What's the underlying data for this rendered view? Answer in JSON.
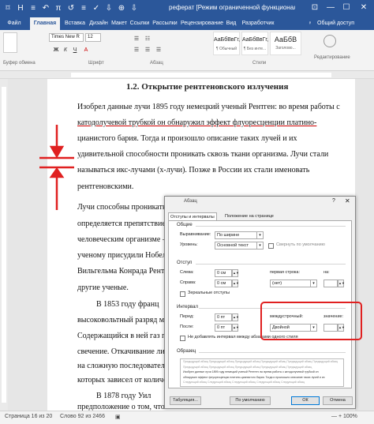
{
  "titlebar": {
    "quick_icons": [
      "⌑",
      "H",
      "≡",
      "↶",
      "π",
      "↺",
      "≡",
      "✓",
      "⇩",
      "⊕",
      "⇩"
    ],
    "title": "реферат [Режим ограниченной функциональ...",
    "window_controls": [
      "⊡",
      "—",
      "☐",
      "✕"
    ]
  },
  "tabs": [
    "Файл",
    "Главная",
    "Вставка",
    "Дизайн",
    "Макет",
    "Ссылки",
    "Рассылки",
    "Рецензирование",
    "Вид",
    "Разработчик"
  ],
  "active_tab": "Главная",
  "help_icon": "♀",
  "share": "Общий доступ",
  "ribbon": {
    "font_name": "Times New R",
    "font_size": "12",
    "groups": [
      "Буфер обмена",
      "Шрифт",
      "Абзац",
      "Стили",
      "Редактирование"
    ],
    "styles": [
      {
        "preview": "АаБбВвГг,",
        "name": "¶ Обычный"
      },
      {
        "preview": "АаБбВвГг,",
        "name": "¶ Без инте..."
      },
      {
        "preview": "АаБбВ",
        "name": "Заголово..."
      }
    ],
    "editing": "Редактирование"
  },
  "document": {
    "heading": "1.2. Открытие рентгеновского излучения",
    "lines": [
      "Изобрел данные лучи 1895 году немецкий ученый Рентген: во время работы с",
      "катодолучевой трубкой он обнаружил эффект флуоресценции платино-",
      "цианистого бария. Тогда и произошло описание таких лучей и их",
      "удивительной способности проникать сквозь ткани организма. Лучи стали",
      "называться икс-лучами (х-лучи). Позже в России их стали именовать",
      "рентгеновскими.",
      "Лучи способны проникать ск",
      "определяется препятствие",
      "человеческим организме —",
      "ученому присудили Нобел",
      "Вильгельма Конрада Рентге",
      "другие ученые.",
      "В 1853 году франц",
      "высоковольтный разряд м",
      "Содержащийся в ней газ при",
      "свечение. Откачивание лишн",
      "на сложную последователь",
      "которых зависел от количест",
      "В 1878 году Уил",
      "предположение о том, что"
    ]
  },
  "dialog": {
    "title": "Абзац",
    "help": "?",
    "close": "✕",
    "tabs": [
      "Отступы и интервалы",
      "Положение на странице"
    ],
    "general_label": "Общие",
    "alignment_label": "Выравнивание:",
    "alignment_value": "По ширине",
    "level_label": "Уровень:",
    "level_value": "Основной текст",
    "collapsed_label": "Свернуть по умолчанию",
    "indent_label": "Отступ",
    "left_label": "Слева:",
    "left_value": "0 см",
    "right_label": "Справа:",
    "right_value": "0 см",
    "first_line_label": "первая строка:",
    "first_line_value": "(нет)",
    "by_label": "на:",
    "mirror_label": "Зеркальные отступы",
    "spacing_label": "Интервал",
    "before_label": "Перед:",
    "before_value": "0 пт",
    "after_label": "После:",
    "after_value": "0 пт",
    "line_spacing_label": "междустрочный:",
    "line_spacing_value": "Двойной",
    "value_label": "значение:",
    "no_space_label": "Не добавлять интервал между абзацами одного стиля",
    "preview_label": "Образец",
    "preview_lines": [
      "Предыдущий абзац Предыдущий абзац Предыдущий абзац Предыдущий абзац Предыдущий абзац Предыдущий абзац",
      "Предыдущий абзац Предыдущий абзац Предыдущий абзац Предыдущий абзац Предыдущий абзац",
      "Изобрел данные лучи 1895 году немецкий ученый Рентген: во время работы с катодолучевой трубкой он",
      "обнаружил эффект флуоресценции платино-цианистого бария. Тогда и произошло описание таких лучей и их",
      "Следующий абзац Следующий абзац Следующий абзац Следующий абзац Следующий абзац"
    ],
    "btn_tabs": "Табуляция...",
    "btn_default": "По умолчанию",
    "btn_ok": "ОК",
    "btn_cancel": "Отмена"
  },
  "status": {
    "page": "Страница 16 из 20",
    "words": "Слово 92 из 2466",
    "proof_icon": "▣",
    "zoom": "— + 100%"
  },
  "colors": {
    "brand": "#2b579a",
    "highlight": "#e02020"
  }
}
